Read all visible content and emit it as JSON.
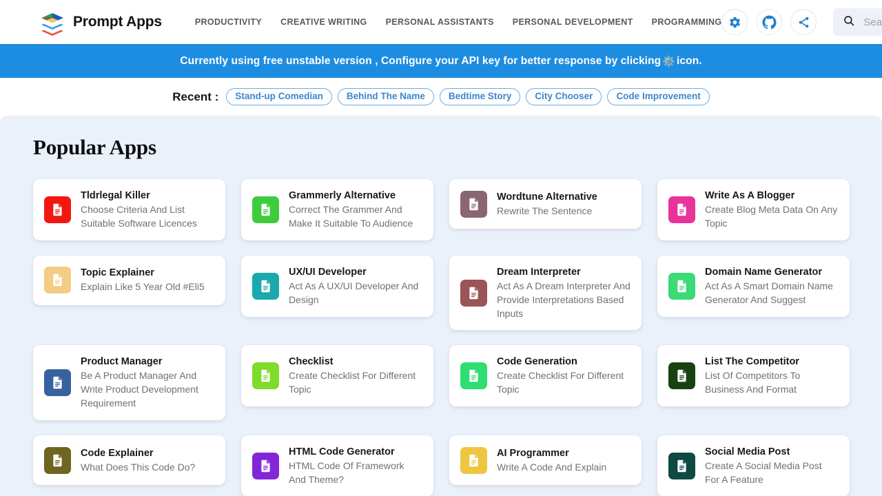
{
  "header": {
    "brand_name": "Prompt Apps",
    "logo_icon": "stacked-layers-logo",
    "nav": [
      {
        "label": "PRODUCTIVITY"
      },
      {
        "label": "CREATIVE WRITING"
      },
      {
        "label": "PERSONAL ASSISTANTS"
      },
      {
        "label": "PERSONAL DEVELOPMENT"
      },
      {
        "label": "PROGRAMMING"
      }
    ],
    "actions": [
      {
        "icon": "gear-icon",
        "name": "settings-button"
      },
      {
        "icon": "github-icon",
        "name": "github-button"
      },
      {
        "icon": "share-icon",
        "name": "share-button"
      }
    ],
    "search": {
      "icon": "search-icon",
      "placeholder": "Search",
      "value": ""
    }
  },
  "banner": {
    "text_before": "Currently using free unstable version , Configure your API key for better response by clicking",
    "gear_glyph": "⚙️",
    "text_after": "icon.",
    "background_color": "#1d8de2",
    "text_color": "#ffffff"
  },
  "recent": {
    "label": "Recent :",
    "chips": [
      {
        "label": "Stand-up Comedian"
      },
      {
        "label": "Behind The Name"
      },
      {
        "label": "Bedtime Story"
      },
      {
        "label": "City Chooser"
      },
      {
        "label": "Code Improvement"
      }
    ],
    "chip_color": "#3d86cc"
  },
  "main": {
    "title": "Popular Apps",
    "background_color": "#eaf1fa",
    "cards": [
      {
        "title": "Tldrlegal Killer",
        "desc": "Choose Criteria And List Suitable Software Licences",
        "color": "#f41711",
        "icon": "document-icon"
      },
      {
        "title": "Grammerly Alternative",
        "desc": "Correct The Grammer And Make It Suitable To Audience",
        "color": "#3ecc3c",
        "icon": "document-icon"
      },
      {
        "title": "Wordtune Alternative",
        "desc": "Rewrite The Sentence",
        "color": "#8a6670",
        "icon": "document-icon"
      },
      {
        "title": "Write As A Blogger",
        "desc": "Create Blog Meta Data On Any Topic",
        "color": "#e8339a",
        "icon": "document-icon"
      },
      {
        "title": "Topic Explainer",
        "desc": "Explain Like 5 Year Old #Eli5",
        "color": "#f2cd83",
        "icon": "document-icon"
      },
      {
        "title": "UX/UI Developer",
        "desc": "Act As A UX/UI Developer And Design",
        "color": "#1aa9ac",
        "icon": "document-icon"
      },
      {
        "title": "Dream Interpreter",
        "desc": "Act As A Dream Interpreter And Provide Interpretations Based Inputs",
        "color": "#9b5457",
        "icon": "document-icon"
      },
      {
        "title": "Domain Name Generator",
        "desc": "Act As A Smart Domain Name Generator And Suggest",
        "color": "#3ada76",
        "icon": "document-icon"
      },
      {
        "title": "Product Manager",
        "desc": "Be A Product Manager And Write Product Development Requirement",
        "color": "#37629f",
        "icon": "document-icon"
      },
      {
        "title": "Checklist",
        "desc": "Create Checklist For Different Topic",
        "color": "#7fdb2c",
        "icon": "document-icon"
      },
      {
        "title": "Code Generation",
        "desc": "Create Checklist For Different Topic",
        "color": "#2fdd72",
        "icon": "document-icon"
      },
      {
        "title": "List The Competitor",
        "desc": "List Of Competitors To Business And Format",
        "color": "#17430f",
        "icon": "document-icon"
      },
      {
        "title": "Code Explainer",
        "desc": "What Does This Code Do?",
        "color": "#6f6420",
        "icon": "document-icon"
      },
      {
        "title": "HTML Code Generator",
        "desc": "HTML Code Of Framework And Theme?",
        "color": "#8326d8",
        "icon": "document-icon"
      },
      {
        "title": "AI Programmer",
        "desc": "Write A Code And Explain",
        "color": "#eec640",
        "icon": "document-icon"
      },
      {
        "title": "Social Media Post",
        "desc": "Create A Social Media Post For A Feature",
        "color": "#0c4a43",
        "icon": "document-icon"
      }
    ]
  }
}
